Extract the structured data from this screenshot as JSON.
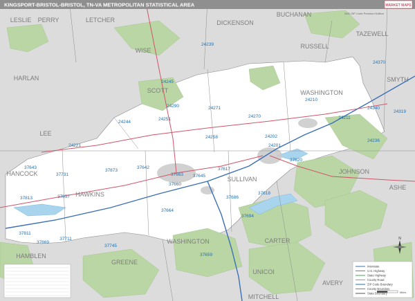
{
  "title": "KINGSPORT-BRISTOL-BRISTOL, TN-VA METROPOLITAN STATISTICAL AREA",
  "subtitle": "2020 ZIP Code Premium Edition",
  "publisher": "MARKET MAPS",
  "colors": {
    "msa_fill": "#ffffff",
    "outside_fill": "#dcdcdc",
    "forest": "#b9d6a4",
    "water": "#a9d4ee",
    "urban": "#c9c9c9",
    "title_bar": "#9a9a9a",
    "zip_label": "#1f6fb0",
    "county_label": "#7d7d7d",
    "interstate": "#3b6fb6",
    "us_highway": "#d0556a",
    "state_line": "#5a5a5a"
  },
  "counties": [
    {
      "name": "LESLIE"
    },
    {
      "name": "PERRY"
    },
    {
      "name": "LETCHER"
    },
    {
      "name": "DICKENSON"
    },
    {
      "name": "BUCHANAN"
    },
    {
      "name": "TAZEWELL"
    },
    {
      "name": "HARLAN"
    },
    {
      "name": "WISE"
    },
    {
      "name": "RUSSELL"
    },
    {
      "name": "SCOTT"
    },
    {
      "name": "WASHINGTON"
    },
    {
      "name": "SMYTH"
    },
    {
      "name": "LEE"
    },
    {
      "name": "HANCOCK"
    },
    {
      "name": "HAWKINS"
    },
    {
      "name": "SULLIVAN"
    },
    {
      "name": "JOHNSON"
    },
    {
      "name": "ASHE"
    },
    {
      "name": "WASHINGTON"
    },
    {
      "name": "CARTER"
    },
    {
      "name": "GREENE"
    },
    {
      "name": "UNICOI"
    },
    {
      "name": "MITCHELL"
    },
    {
      "name": "AVERY"
    },
    {
      "name": "HAMBLEN"
    }
  ],
  "zips": [
    "24239",
    "24245",
    "24290",
    "24271",
    "24244",
    "24251",
    "24258",
    "24270",
    "24210",
    "24370",
    "24340",
    "24319",
    "24211",
    "24202",
    "24201",
    "24236",
    "24221",
    "37620",
    "37642",
    "37663",
    "37660",
    "37617",
    "37618",
    "37694",
    "37643",
    "37731",
    "37873",
    "37857",
    "37811",
    "37869",
    "37711",
    "37745",
    "37659",
    "37813",
    "37645",
    "37664",
    "37686",
    "37660",
    "37664"
  ],
  "legend": {
    "items": [
      "Interstate",
      "U.S. Highway",
      "State Highway",
      "County Road",
      "ZIP Code Boundary",
      "County Boundary",
      "State Boundary"
    ]
  },
  "scale_label": "Miles"
}
